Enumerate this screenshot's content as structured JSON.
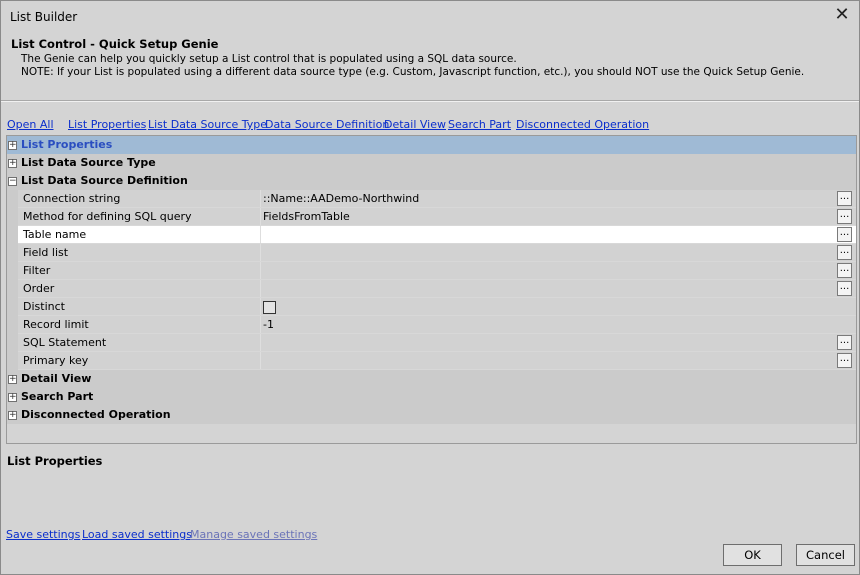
{
  "window": {
    "title": "List Builder"
  },
  "genie": {
    "header": "List Control - Quick Setup Genie",
    "line1": "The Genie can help you quickly setup a List control that is populated using a SQL data source.",
    "line2": "NOTE: If your List is populated using a different data source type (e.g. Custom, Javascript function, etc.), you should NOT use the Quick Setup Genie."
  },
  "nav": {
    "open_all": "Open All",
    "list_properties": "List Properties",
    "list_data_source_type": "List Data Source Type",
    "data_source_definition": "Data Source Definition",
    "detail_view": "Detail View",
    "search_part": "Search Part",
    "disconnected_operation": "Disconnected Operation"
  },
  "grid": {
    "categories": {
      "list_properties": "List Properties",
      "list_data_source_type": "List Data Source Type",
      "list_data_source_definition": "List Data Source Definition",
      "detail_view": "Detail View",
      "search_part": "Search Part",
      "disconnected_operation": "Disconnected Operation"
    },
    "expander": {
      "plus": "+",
      "minus": "−"
    },
    "rows": [
      {
        "name": "Connection string",
        "value": "::Name::AADemo-Northwind",
        "ellipsis": true
      },
      {
        "name": "Method for defining SQL query",
        "value": "FieldsFromTable",
        "ellipsis": true
      },
      {
        "name": "Table name",
        "value": "",
        "ellipsis": true
      },
      {
        "name": "Field list",
        "value": "",
        "ellipsis": true
      },
      {
        "name": "Filter",
        "value": "",
        "ellipsis": true
      },
      {
        "name": "Order",
        "value": "",
        "ellipsis": true
      },
      {
        "name": "Distinct",
        "value": "",
        "checkbox": true,
        "checked": false
      },
      {
        "name": "Record limit",
        "value": "-1"
      },
      {
        "name": "SQL Statement",
        "value": "",
        "ellipsis": true
      },
      {
        "name": "Primary key",
        "value": "",
        "ellipsis": true
      }
    ],
    "ellipsis_label": "..."
  },
  "description_panel": {
    "title": "List Properties"
  },
  "footer": {
    "save_settings": "Save settings",
    "load_saved_settings": "Load saved settings",
    "manage_saved_settings": "Manage saved settings",
    "ok": "OK",
    "cancel": "Cancel"
  },
  "icons": {
    "close": "close-icon"
  }
}
